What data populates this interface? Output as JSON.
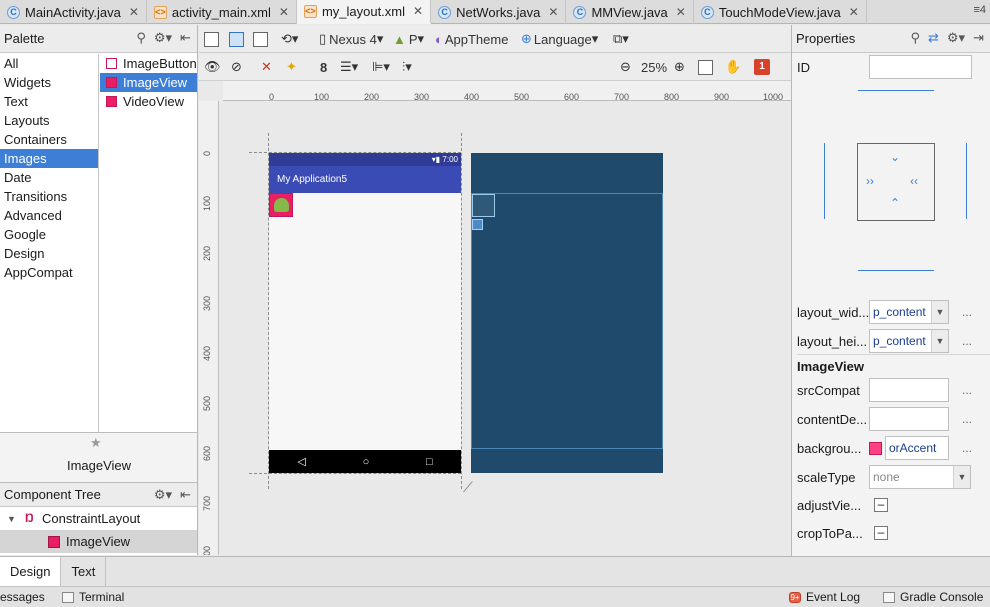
{
  "tabs": [
    {
      "label": "MainActivity.java",
      "type": "java",
      "active": false
    },
    {
      "label": "activity_main.xml",
      "type": "xml",
      "active": false
    },
    {
      "label": "my_layout.xml",
      "type": "xml",
      "active": true
    },
    {
      "label": "NetWorks.java",
      "type": "java",
      "active": false
    },
    {
      "label": "MMView.java",
      "type": "java",
      "active": false
    },
    {
      "label": "TouchModeView.java",
      "type": "java",
      "active": false
    }
  ],
  "tab_menu": "≡4",
  "palette": {
    "title": "Palette",
    "categories": [
      "All",
      "Widgets",
      "Text",
      "Layouts",
      "Containers",
      "Images",
      "Date",
      "Transitions",
      "Advanced",
      "Google",
      "Design",
      "AppCompat"
    ],
    "selected_category": "Images",
    "items": [
      "ImageButton",
      "ImageView",
      "VideoView"
    ],
    "selected_item": "ImageView"
  },
  "preview": {
    "label": "ImageView"
  },
  "component_tree": {
    "title": "Component Tree",
    "nodes": [
      {
        "label": "ConstraintLayout",
        "level": 0
      },
      {
        "label": "ImageView",
        "level": 1
      }
    ]
  },
  "toolbar": {
    "device": "Nexus 4",
    "api": "P",
    "theme": "AppTheme",
    "language": "Language",
    "margin_value": "8",
    "zoom": "25%",
    "warnings": "1"
  },
  "canvas": {
    "hruler_ticks": [
      "0",
      "100",
      "200",
      "300",
      "400",
      "500",
      "600",
      "700",
      "800",
      "900",
      "1000"
    ],
    "vruler_ticks": [
      "0",
      "100",
      "200",
      "300",
      "400",
      "500",
      "600",
      "700",
      "800"
    ],
    "phone": {
      "status_time": "7:00",
      "app_title": "My Application5",
      "nav_back": "◁",
      "nav_home": "○",
      "nav_recent": "□"
    }
  },
  "properties": {
    "title": "Properties",
    "id_label": "ID",
    "id_value": "",
    "layout_width_label": "layout_wid...",
    "layout_width_value": "p_content",
    "layout_height_label": "layout_hei...",
    "layout_height_value": "p_content",
    "section_title": "ImageView",
    "src_label": "srcCompat",
    "content_label": "contentDe...",
    "background_label": "backgrou...",
    "background_value": "orAccent",
    "scale_label": "scaleType",
    "scale_value": "none",
    "adjust_label": "adjustVie...",
    "crop_label": "cropToPa...",
    "more_dots": "..."
  },
  "bottom_tabs": [
    "Design",
    "Text"
  ],
  "active_bottom_tab": "Design",
  "status_bar": {
    "messages": "essages",
    "terminal": "Terminal",
    "event_log": "Event Log",
    "gradle": "Gradle Console",
    "event_badge": "9+"
  },
  "colors": {
    "accent": "#3d7fd6",
    "blueprint": "#1f4a6c",
    "app_bar": "#3b4bb6",
    "image_pink": "#e91e63"
  }
}
